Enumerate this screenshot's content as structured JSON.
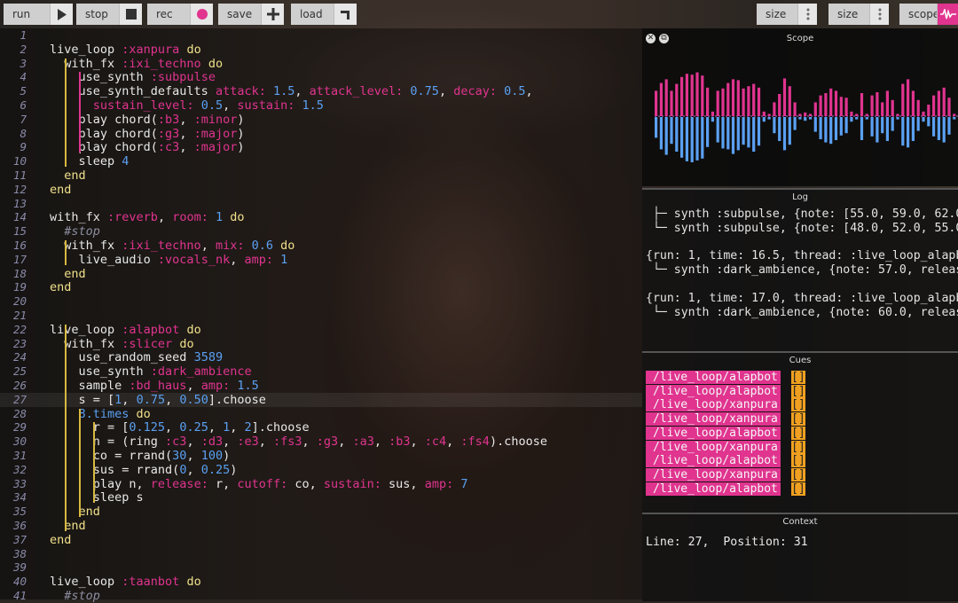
{
  "toolbar": {
    "run": "run",
    "stop": "stop",
    "rec": "rec",
    "save": "save",
    "load": "load",
    "size1": "size",
    "size2": "size",
    "scope": "scope"
  },
  "colors": {
    "pink": "#e0348f",
    "orange": "#f0a020",
    "blue": "#5aa0f2",
    "keyword": "#f0e08a"
  },
  "editor": {
    "highlight_line": 27,
    "lines": [
      [],
      [
        [
          "live_loop ",
          ""
        ],
        [
          ":xanpura",
          "sym"
        ],
        [
          " do",
          "kw"
        ]
      ],
      [
        [
          "  with_fx ",
          ""
        ],
        [
          ":ixi_techno",
          "sym"
        ],
        [
          " do",
          "kw"
        ]
      ],
      [
        [
          "    use_synth ",
          ""
        ],
        [
          ":subpulse",
          "sym"
        ]
      ],
      [
        [
          "    use_synth_defaults ",
          ""
        ],
        [
          "attack:",
          "sym"
        ],
        [
          " 1.5",
          "num"
        ],
        [
          ", ",
          ""
        ],
        [
          "attack_level:",
          "sym"
        ],
        [
          " 0.75",
          "num"
        ],
        [
          ", ",
          ""
        ],
        [
          "decay:",
          "sym"
        ],
        [
          " 0.5",
          "num"
        ],
        [
          ",",
          ""
        ]
      ],
      [
        [
          "      ",
          ""
        ],
        [
          "sustain_level:",
          "sym"
        ],
        [
          " 0.5",
          "num"
        ],
        [
          ", ",
          ""
        ],
        [
          "sustain:",
          "sym"
        ],
        [
          " 1.5",
          "num"
        ]
      ],
      [
        [
          "    play chord(",
          ""
        ],
        [
          ":b3",
          "sym"
        ],
        [
          ", ",
          ""
        ],
        [
          ":minor",
          "sym"
        ],
        [
          ")",
          ""
        ]
      ],
      [
        [
          "    play chord(",
          ""
        ],
        [
          ":g3",
          "sym"
        ],
        [
          ", ",
          ""
        ],
        [
          ":major",
          "sym"
        ],
        [
          ")",
          ""
        ]
      ],
      [
        [
          "    play chord(",
          ""
        ],
        [
          ":c3",
          "sym"
        ],
        [
          ", ",
          ""
        ],
        [
          ":major",
          "sym"
        ],
        [
          ")",
          ""
        ]
      ],
      [
        [
          "    sleep ",
          ""
        ],
        [
          "4",
          "num"
        ]
      ],
      [
        [
          "  end",
          "kw"
        ]
      ],
      [
        [
          "end",
          "kw"
        ]
      ],
      [],
      [
        [
          "with_fx ",
          ""
        ],
        [
          ":reverb",
          "sym"
        ],
        [
          ", ",
          ""
        ],
        [
          "room:",
          "sym"
        ],
        [
          " 1",
          "num"
        ],
        [
          " do",
          "kw"
        ]
      ],
      [
        [
          "  #stop",
          "cm"
        ]
      ],
      [
        [
          "  with_fx ",
          ""
        ],
        [
          ":ixi_techno",
          "sym"
        ],
        [
          ", ",
          ""
        ],
        [
          "mix:",
          "sym"
        ],
        [
          " 0.6",
          "num"
        ],
        [
          " do",
          "kw"
        ]
      ],
      [
        [
          "    live_audio ",
          ""
        ],
        [
          ":vocals_nk",
          "sym"
        ],
        [
          ", ",
          ""
        ],
        [
          "amp:",
          "sym"
        ],
        [
          " 1",
          "num"
        ]
      ],
      [
        [
          "  end",
          "kw"
        ]
      ],
      [
        [
          "end",
          "kw"
        ]
      ],
      [],
      [],
      [
        [
          "live_loop ",
          ""
        ],
        [
          ":alapbot",
          "sym"
        ],
        [
          " do",
          "kw"
        ]
      ],
      [
        [
          "  with_fx ",
          ""
        ],
        [
          ":slicer",
          "sym"
        ],
        [
          " do",
          "kw"
        ]
      ],
      [
        [
          "    use_random_seed ",
          ""
        ],
        [
          "3589",
          "num"
        ]
      ],
      [
        [
          "    use_synth ",
          ""
        ],
        [
          ":dark_ambience",
          "sym"
        ]
      ],
      [
        [
          "    sample ",
          ""
        ],
        [
          ":bd_haus",
          "sym"
        ],
        [
          ", ",
          ""
        ],
        [
          "amp:",
          "sym"
        ],
        [
          " 1.5",
          "num"
        ]
      ],
      [
        [
          "    s = [",
          ""
        ],
        [
          "1",
          "num"
        ],
        [
          ", ",
          ""
        ],
        [
          "0.75",
          "num"
        ],
        [
          ", ",
          ""
        ],
        [
          "0.50",
          "num"
        ],
        [
          "].choose",
          ""
        ]
      ],
      [
        [
          "    8.times",
          "num"
        ],
        [
          " do",
          "kw"
        ]
      ],
      [
        [
          "      r = [",
          ""
        ],
        [
          "0.125",
          "num"
        ],
        [
          ", ",
          ""
        ],
        [
          "0.25",
          "num"
        ],
        [
          ", ",
          ""
        ],
        [
          "1",
          "num"
        ],
        [
          ", ",
          ""
        ],
        [
          "2",
          "num"
        ],
        [
          "].choose",
          ""
        ]
      ],
      [
        [
          "      n = (ring ",
          ""
        ],
        [
          ":c3",
          "sym"
        ],
        [
          ", ",
          ""
        ],
        [
          ":d3",
          "sym"
        ],
        [
          ", ",
          ""
        ],
        [
          ":e3",
          "sym"
        ],
        [
          ", ",
          ""
        ],
        [
          ":fs3",
          "sym"
        ],
        [
          ", ",
          ""
        ],
        [
          ":g3",
          "sym"
        ],
        [
          ", ",
          ""
        ],
        [
          ":a3",
          "sym"
        ],
        [
          ", ",
          ""
        ],
        [
          ":b3",
          "sym"
        ],
        [
          ", ",
          ""
        ],
        [
          ":c4",
          "sym"
        ],
        [
          ", ",
          ""
        ],
        [
          ":fs4",
          "sym"
        ],
        [
          ").choose",
          ""
        ]
      ],
      [
        [
          "      co = rrand(",
          ""
        ],
        [
          "30",
          "num"
        ],
        [
          ", ",
          ""
        ],
        [
          "100",
          "num"
        ],
        [
          ")",
          ""
        ]
      ],
      [
        [
          "      sus = rrand(",
          ""
        ],
        [
          "0",
          "num"
        ],
        [
          ", ",
          ""
        ],
        [
          "0.25",
          "num"
        ],
        [
          ")",
          ""
        ]
      ],
      [
        [
          "      play n, ",
          ""
        ],
        [
          "release:",
          "sym"
        ],
        [
          " r, ",
          ""
        ],
        [
          "cutoff:",
          "sym"
        ],
        [
          " co, ",
          ""
        ],
        [
          "sustain:",
          "sym"
        ],
        [
          " sus, ",
          ""
        ],
        [
          "amp:",
          "sym"
        ],
        [
          " 7",
          "num"
        ]
      ],
      [
        [
          "      sleep s",
          ""
        ]
      ],
      [
        [
          "    end",
          "kw"
        ]
      ],
      [
        [
          "  end",
          "kw"
        ]
      ],
      [
        [
          "end",
          "kw"
        ]
      ],
      [],
      [],
      [
        [
          "live_loop ",
          ""
        ],
        [
          ":taanbot",
          "sym"
        ],
        [
          " do",
          "kw"
        ]
      ],
      [
        [
          "  #stop",
          "cm"
        ]
      ]
    ]
  },
  "scope": {
    "title": "Scope",
    "top_levels": [
      0.55,
      0.72,
      0.8,
      0.55,
      0.7,
      0.85,
      0.92,
      0.9,
      0.95,
      0.88,
      0.62,
      0.1,
      0.55,
      0.6,
      0.72,
      0.8,
      0.78,
      0.6,
      0.65,
      0.7,
      0.62,
      0.1,
      0.05,
      0.3,
      0.48,
      0.82,
      0.65,
      0.3,
      0.05,
      0.08,
      0.05,
      0.3,
      0.45,
      0.5,
      0.6,
      0.55,
      0.42,
      0.4,
      0.1,
      0.05,
      0.5,
      0.05,
      0.45,
      0.52,
      0.3,
      0.55,
      0.35,
      0.05,
      0.7,
      0.8,
      0.55,
      0.35,
      0.1,
      0.25,
      0.45,
      0.55,
      0.62,
      0.4,
      0.05
    ],
    "bottom_levels": [
      0.45,
      0.7,
      0.82,
      0.58,
      0.75,
      0.88,
      0.96,
      0.98,
      0.94,
      0.9,
      0.65,
      0.1,
      0.55,
      0.68,
      0.7,
      0.8,
      0.72,
      0.6,
      0.66,
      0.75,
      0.62,
      0.1,
      0.05,
      0.35,
      0.52,
      0.72,
      0.6,
      0.28,
      0.05,
      0.08,
      0.05,
      0.32,
      0.48,
      0.55,
      0.58,
      0.5,
      0.4,
      0.35,
      0.1,
      0.05,
      0.5,
      0.05,
      0.42,
      0.55,
      0.35,
      0.52,
      0.3,
      0.05,
      0.62,
      0.66,
      0.52,
      0.3,
      0.1,
      0.2,
      0.42,
      0.5,
      0.55,
      0.38,
      0.05
    ]
  },
  "log": {
    "title": "Log",
    "lines": [
      " ├─ synth :subpulse, {note: [55.0, 59.0, 62.0",
      " └─ synth :subpulse, {note: [48.0, 52.0, 55.0",
      "",
      "{run: 1, time: 16.5, thread: :live_loop_alapb",
      " └─ synth :dark_ambience, {note: 57.0, releas",
      "",
      "{run: 1, time: 17.0, thread: :live_loop_alapb",
      " └─ synth :dark_ambience, {note: 60.0, releas"
    ]
  },
  "cues": {
    "title": "Cues",
    "items": [
      {
        "path": "/live_loop/alapbot",
        "value": "[]"
      },
      {
        "path": "/live_loop/alapbot",
        "value": "[]"
      },
      {
        "path": "/live_loop/xanpura",
        "value": "[]"
      },
      {
        "path": "/live_loop/xanpura",
        "value": "[]"
      },
      {
        "path": "/live_loop/alapbot",
        "value": "[]"
      },
      {
        "path": "/live_loop/xanpura",
        "value": "[]"
      },
      {
        "path": "/live_loop/alapbot",
        "value": "[]"
      },
      {
        "path": "/live_loop/xanpura",
        "value": "[]"
      },
      {
        "path": "/live_loop/alapbot",
        "value": "[]"
      }
    ]
  },
  "context": {
    "title": "Context",
    "text": "Line: 27,  Position: 31"
  }
}
